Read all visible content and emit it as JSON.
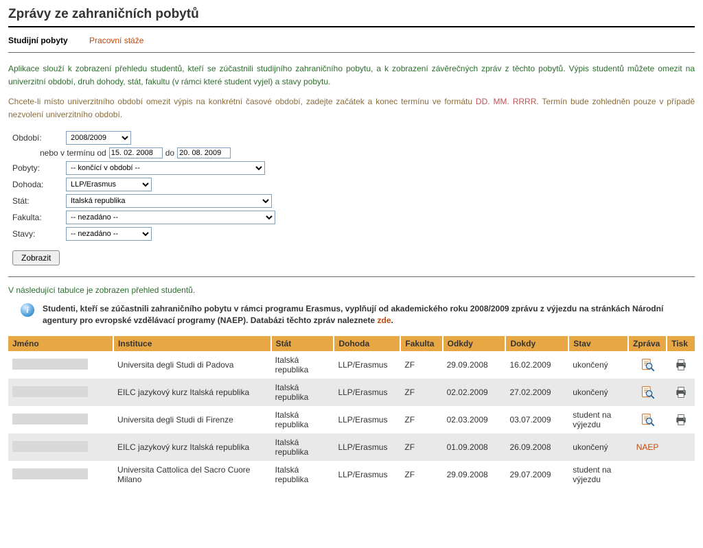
{
  "title": "Zprávy ze zahraničních pobytů",
  "tabs": {
    "study": "Studijní pobyty",
    "work": "Pracovní stáže"
  },
  "intro": "Aplikace slouží k zobrazení přehledu studentů, kteří se zúčastnili studijního zahraničního pobytu, a k zobrazení závěrečných zpráv z těchto pobytů. Výpis studentů můžete omezit na univerzitní období, druh dohody, stát, fakultu (v rámci které student vyjel) a stavy pobytu.",
  "intro2_a": "Chcete-li místo univerzitního období omezit výpis na konkrétní časové období, zadejte začátek a konec termínu ve formátu ",
  "intro2_fmt": "DD. MM. RRRR",
  "intro2_b": ". Termín bude zohledněn pouze v případě nezvolení univerzitního období.",
  "form": {
    "obdobi_label": "Období:",
    "obdobi_value": "2008/2009",
    "termin_label": "nebo v termínu od",
    "termin_from": "15. 02. 2008",
    "termin_to_label": "do",
    "termin_to": "20. 08. 2009",
    "pobyty_label": "Pobyty:",
    "pobyty_value": "-- končící v období --",
    "dohoda_label": "Dohoda:",
    "dohoda_value": "LLP/Erasmus",
    "stat_label": "Stát:",
    "stat_value": "Italská republika",
    "fakulta_label": "Fakulta:",
    "fakulta_value": "-- nezadáno --",
    "stavy_label": "Stavy:",
    "stavy_value": "-- nezadáno --",
    "submit": "Zobrazit"
  },
  "tableintro": "V následující tabulce je zobrazen přehled studentů.",
  "note_text": "Studenti, kteří se zúčastnili zahraničního pobytu v rámci programu Erasmus, vyplňují od akademického roku 2008/2009 zprávu z výjezdu na stránkách Národní agentury pro evropské vzdělávací programy (NAEP). Databázi těchto zpráv naleznete ",
  "note_link": "zde",
  "note_dot": ".",
  "headers": {
    "jmeno": "Jméno",
    "instituce": "Instituce",
    "stat": "Stát",
    "dohoda": "Dohoda",
    "fakulta": "Fakulta",
    "odkdy": "Odkdy",
    "dokdy": "Dokdy",
    "stav": "Stav",
    "zprava": "Zpráva",
    "tisk": "Tisk"
  },
  "rows": [
    {
      "inst": "Universita degli Studi di Padova",
      "stat": "Italská republika",
      "doh": "LLP/Erasmus",
      "fak": "ZF",
      "od": "29.09.2008",
      "do": "16.02.2009",
      "stav": "ukončený",
      "zprava": "mag",
      "tisk": true
    },
    {
      "inst": "EILC jazykový kurz Italská republika",
      "stat": "Italská republika",
      "doh": "LLP/Erasmus",
      "fak": "ZF",
      "od": "02.02.2009",
      "do": "27.02.2009",
      "stav": "ukončený",
      "zprava": "mag",
      "tisk": true
    },
    {
      "inst": "Universita degli Studi di Firenze",
      "stat": "Italská republika",
      "doh": "LLP/Erasmus",
      "fak": "ZF",
      "od": "02.03.2009",
      "do": "03.07.2009",
      "stav": "student na výjezdu",
      "zprava": "mag",
      "tisk": true
    },
    {
      "inst": "EILC jazykový kurz Italská republika",
      "stat": "Italská republika",
      "doh": "LLP/Erasmus",
      "fak": "ZF",
      "od": "01.09.2008",
      "do": "26.09.2008",
      "stav": "ukončený",
      "zprava": "NAEP",
      "tisk": false
    },
    {
      "inst": "Universita Cattolica del Sacro Cuore Milano",
      "stat": "Italská republika",
      "doh": "LLP/Erasmus",
      "fak": "ZF",
      "od": "29.09.2008",
      "do": "29.07.2009",
      "stav": "student na výjezdu",
      "zprava": "",
      "tisk": false
    }
  ],
  "naep_text": "NAEP"
}
